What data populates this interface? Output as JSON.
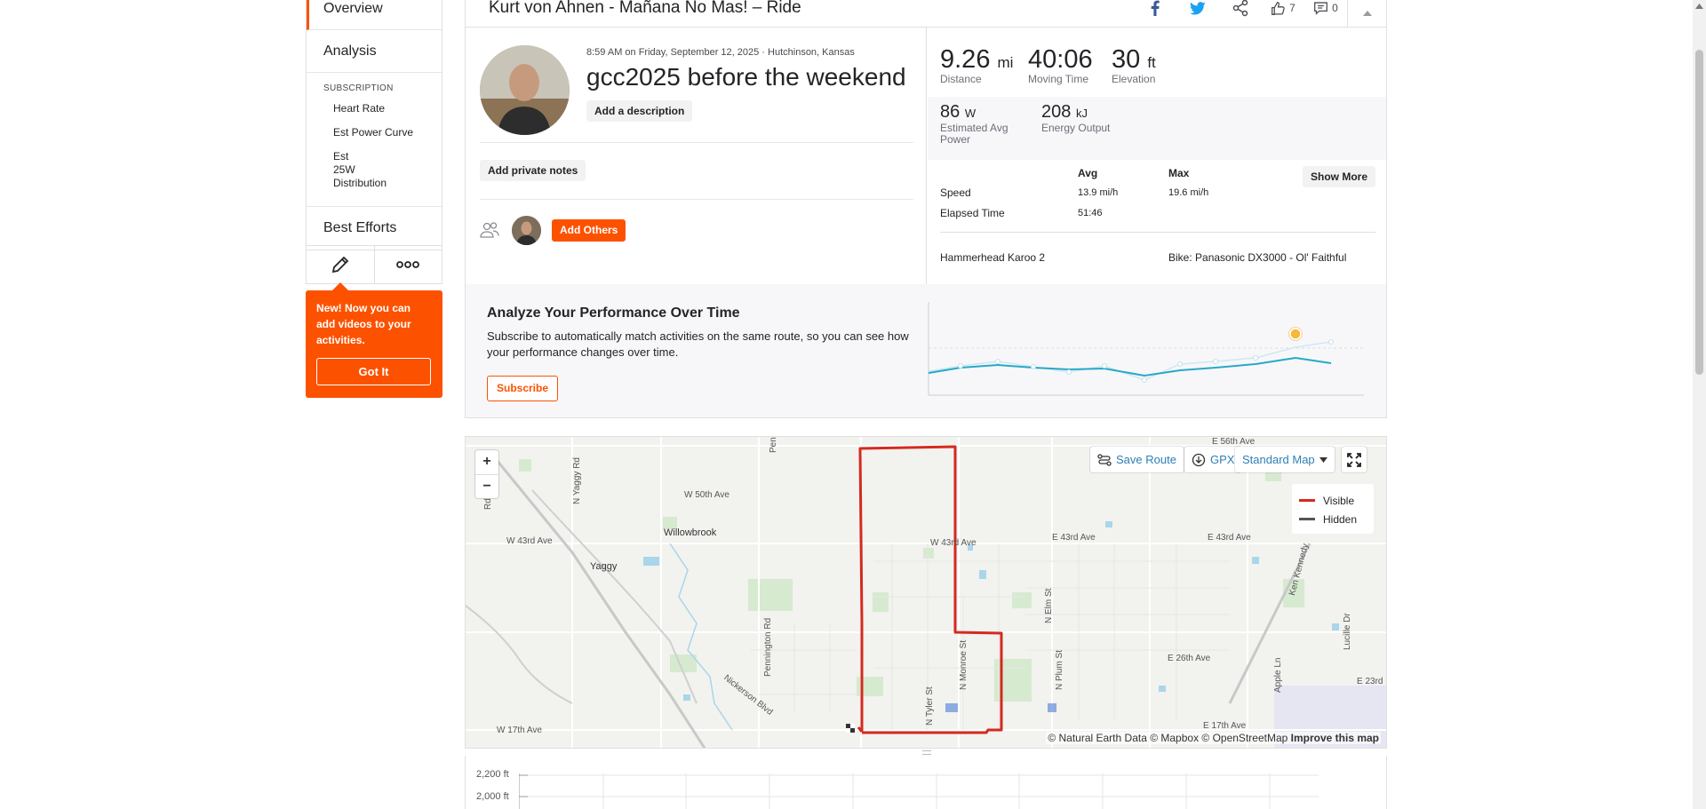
{
  "sidebar": {
    "overview": "Overview",
    "analysis": "Analysis",
    "subscription_head": "SUBSCRIPTION",
    "sub_items": [
      "Heart Rate",
      "Est Power Curve",
      "Est 25W Distribution"
    ],
    "best_efforts": "Best Efforts"
  },
  "tooltip": {
    "text": "New! Now you can add videos to your activities.",
    "button": "Got It"
  },
  "header": {
    "title": "Kurt von Ahnen - Mañana No Mas! – Ride",
    "kudos_count": "7",
    "comment_count": "0"
  },
  "activity": {
    "meta": "8:59 AM on Friday, September 12, 2025 · Hutchinson, Kansas",
    "title": "gcc2025 before the weekend",
    "add_description": "Add a description",
    "add_private_notes": "Add private notes",
    "add_others": "Add Others"
  },
  "stats": {
    "distance": {
      "value": "9.26",
      "unit": "mi",
      "label": "Distance"
    },
    "moving_time": {
      "value": "40:06",
      "label": "Moving Time"
    },
    "elevation": {
      "value": "30",
      "unit": "ft",
      "label": "Elevation"
    },
    "power": {
      "value": "86",
      "unit": "W",
      "label": "Estimated Avg Power"
    },
    "energy": {
      "value": "208",
      "unit": "kJ",
      "label": "Energy Output"
    }
  },
  "table": {
    "headers": {
      "avg": "Avg",
      "max": "Max"
    },
    "show_more": "Show More",
    "rows": [
      {
        "label": "Speed",
        "avg": "13.9 mi/h",
        "max": "19.6 mi/h"
      },
      {
        "label": "Elapsed Time",
        "avg": "51:46",
        "max": ""
      }
    ],
    "device": "Hammerhead Karoo 2",
    "bike": "Bike: Panasonic DX3000 - Ol' Faithful"
  },
  "analyze": {
    "title": "Analyze Your Performance Over Time",
    "text": "Subscribe to automatically match activities on the same route, so you can see how your performance changes over time.",
    "button": "Subscribe"
  },
  "map": {
    "save_route": "Save Route",
    "gpx": "GPX",
    "map_style": "Standard Map",
    "legend_visible": "Visible",
    "legend_hidden": "Hidden",
    "attribution": "© Natural Earth Data © Mapbox © OpenStreetMap",
    "improve": "Improve this map",
    "labels": {
      "w50": "W 50th Ave",
      "willowbrook": "Willowbrook",
      "w43a": "W 43rd Ave",
      "yaggy": "Yaggy",
      "w43b": "W 43rd Ave",
      "e43a": "E 43rd Ave",
      "e43b": "E 43rd Ave",
      "e26": "E 26th Ave",
      "e23": "E 23rd",
      "e17": "E 17th Ave",
      "w17": "W 17th Ave",
      "e56": "E 56th Ave",
      "nickerson": "Nickerson Blvd",
      "pennington": "Pennington Rd",
      "yaggyrd": "N Yaggy Rd",
      "monroe": "N Monroe St",
      "tyler": "N Tyler St",
      "plum": "N Plum St",
      "elm": "N Elm St",
      "apple": "Apple Ln",
      "kennedy": "Ken Kennedy",
      "lucille": "Lucille Dr",
      "pen": "Pen",
      "rd": "Rd"
    },
    "colors": {
      "visible": "#d42a1e",
      "hidden": "#555555"
    }
  },
  "elevation": {
    "ticks": [
      "2,200 ft",
      "2,000 ft"
    ]
  }
}
